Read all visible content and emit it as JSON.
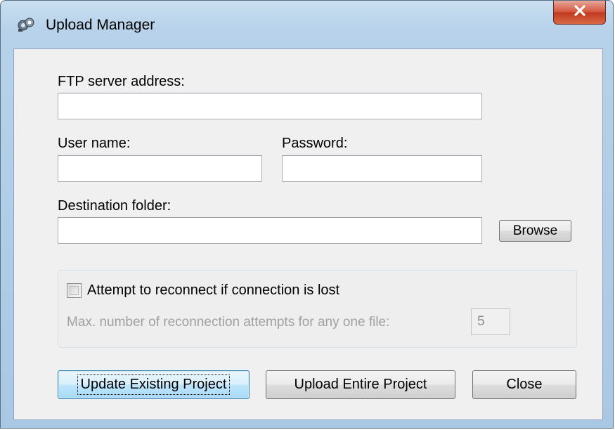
{
  "window": {
    "title": "Upload Manager",
    "app_icon": "upload-manager-icon",
    "close_icon": "close-icon"
  },
  "form": {
    "ftp_label": "FTP server address:",
    "ftp_value": "",
    "username_label": "User name:",
    "username_value": "",
    "password_label": "Password:",
    "password_value": "",
    "destination_label": "Destination folder:",
    "destination_value": "",
    "browse_label": "Browse"
  },
  "reconnect": {
    "checkbox_label": "Attempt to reconnect if connection is lost",
    "checked": false,
    "max_attempts_label": "Max. number of reconnection attempts for any one file:",
    "max_attempts_value": "5"
  },
  "actions": {
    "update_label": "Update Existing Project",
    "upload_label": "Upload Entire Project",
    "close_label": "Close"
  },
  "colors": {
    "close_button": "#c9452a",
    "default_button_border": "#3c7fb1"
  }
}
